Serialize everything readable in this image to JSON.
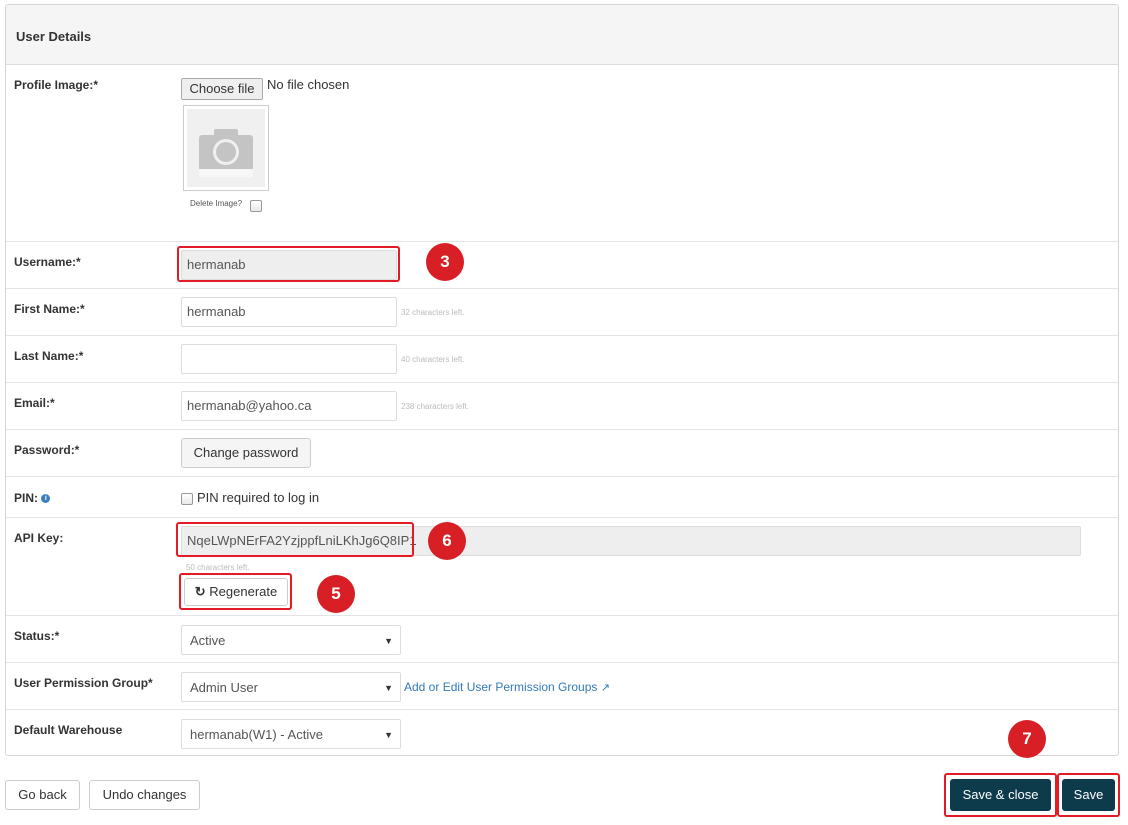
{
  "panel": {
    "title": "User Details"
  },
  "profile_image": {
    "label": "Profile Image:*",
    "choose_file": "Choose file",
    "no_file": "No file chosen",
    "delete_label": "Delete Image?",
    "placeholder_icon": "camera-icon"
  },
  "username": {
    "label": "Username:*",
    "value": "hermanab"
  },
  "first_name": {
    "label": "First Name:*",
    "value": "hermanab",
    "hint": "32 characters left."
  },
  "last_name": {
    "label": "Last Name:*",
    "value": "",
    "hint": "40 characters left."
  },
  "email": {
    "label": "Email:*",
    "value": "hermanab@yahoo.ca",
    "hint": "238 characters left."
  },
  "password": {
    "label": "Password:*",
    "button": "Change password"
  },
  "pin": {
    "label": "PIN:",
    "info_icon": "info-icon",
    "checkbox_label": "PIN required to log in"
  },
  "api_key": {
    "label": "API Key:",
    "value": "NqeLWpNErFA2YzjppfLniLKhJg6Q8IP1",
    "hint": "50 characters left.",
    "regenerate": "Regenerate",
    "regenerate_icon": "refresh-icon"
  },
  "status": {
    "label": "Status:*",
    "selected": "Active"
  },
  "permission_group": {
    "label": "User Permission Group*",
    "selected": "Admin User",
    "link": "Add or Edit User Permission Groups",
    "link_icon": "external-link-icon"
  },
  "warehouse": {
    "label": "Default Warehouse",
    "selected": "hermanab(W1) - Active"
  },
  "footer": {
    "go_back": "Go back",
    "undo": "Undo changes",
    "save_close": "Save & close",
    "save": "Save"
  },
  "annotations": {
    "badge_3": "3",
    "badge_5": "5",
    "badge_6": "6",
    "badge_7": "7"
  },
  "colors": {
    "annotation_red": "#d81f26",
    "primary_dark": "#0d3b4c",
    "link": "#337ab7"
  }
}
